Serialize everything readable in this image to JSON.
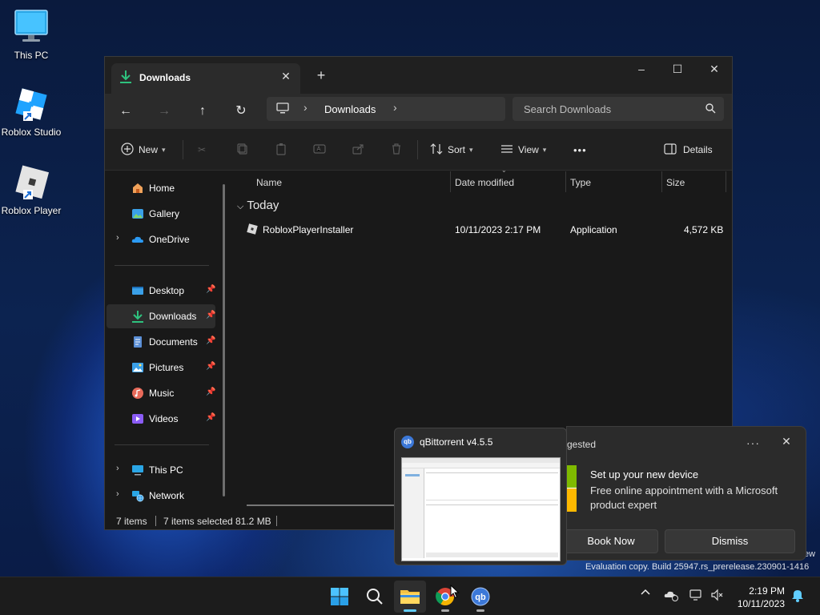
{
  "desktop": {
    "icons": [
      {
        "label": "This PC",
        "icon": "monitor-icon"
      },
      {
        "label": "Roblox Studio",
        "icon": "roblox-studio-icon"
      },
      {
        "label": "Roblox Player",
        "icon": "roblox-player-icon"
      }
    ],
    "watermark": {
      "line1_partial": "ew",
      "line2": "Evaluation copy. Build 25947.rs_prerelease.230901-1416"
    }
  },
  "explorer": {
    "tab": {
      "title": "Downloads",
      "close_glyph": "✕",
      "icon": "download-icon"
    },
    "new_tab_glyph": "+",
    "window_controls": {
      "minimize": "–",
      "maximize": "☐",
      "close": "✕"
    },
    "nav": {
      "back": "←",
      "forward": "→",
      "up": "↑",
      "refresh": "↻"
    },
    "address": {
      "separator": "›",
      "current": "Downloads"
    },
    "search": {
      "placeholder": "Search Downloads"
    },
    "commands": {
      "new": "New",
      "sort": "Sort",
      "view": "View",
      "more": "•••",
      "details": "Details"
    },
    "sidebar": {
      "quick": [
        {
          "label": "Home",
          "icon": "home-icon"
        },
        {
          "label": "Gallery",
          "icon": "gallery-icon"
        },
        {
          "label": "OneDrive",
          "icon": "onedrive-icon",
          "expandable": true
        }
      ],
      "pinned": [
        {
          "label": "Desktop",
          "icon": "desktop-folder-icon"
        },
        {
          "label": "Downloads",
          "icon": "download-icon",
          "selected": true
        },
        {
          "label": "Documents",
          "icon": "documents-icon"
        },
        {
          "label": "Pictures",
          "icon": "pictures-icon"
        },
        {
          "label": "Music",
          "icon": "music-icon"
        },
        {
          "label": "Videos",
          "icon": "videos-icon"
        }
      ],
      "devices": [
        {
          "label": "This PC",
          "icon": "this-pc-icon"
        },
        {
          "label": "Network",
          "icon": "network-icon"
        }
      ]
    },
    "columns": {
      "name": "Name",
      "date": "Date modified",
      "type": "Type",
      "size": "Size"
    },
    "group": {
      "label": "Today"
    },
    "files": [
      {
        "name": "RobloxPlayerInstaller",
        "date": "10/11/2023 2:17 PM",
        "type": "Application",
        "size": "4,572 KB"
      }
    ],
    "status": {
      "count": "7 items",
      "selected": "7 items selected",
      "size": "81.2 MB"
    }
  },
  "qbittorrent_thumbnail": {
    "title": "qBittorrent v4.5.5",
    "logo_text": "qb"
  },
  "toast": {
    "app_partial": "gested",
    "more": "···",
    "close": "✕",
    "title": "Set up your new device",
    "body": "Free online appointment with a Microsoft product expert",
    "primary_button": "Book Now",
    "secondary_button": "Dismiss",
    "badge_colors": [
      "#7fba00",
      "#ffb900"
    ]
  },
  "taskbar": {
    "items": [
      "start-button",
      "search-button",
      "file-explorer-button",
      "chrome-button",
      "qbittorrent-button"
    ],
    "tray_chevron": "^",
    "clock": {
      "time": "2:19 PM",
      "date": "10/11/2023"
    }
  }
}
